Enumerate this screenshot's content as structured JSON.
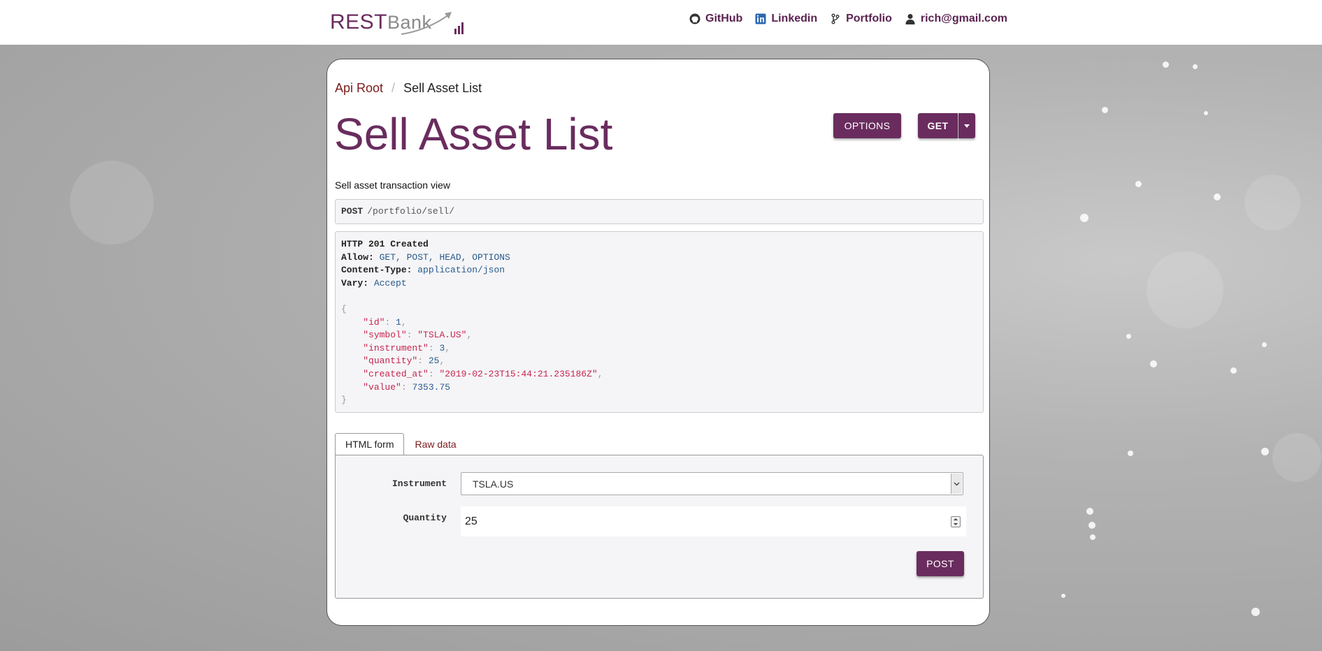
{
  "navbar": {
    "brand_rest": "REST",
    "brand_bank": "Bank",
    "links": [
      {
        "label": "GitHub",
        "icon": "github-icon"
      },
      {
        "label": "Linkedin",
        "icon": "linkedin-icon"
      },
      {
        "label": "Portfolio",
        "icon": "branch-icon"
      },
      {
        "label": "rich@gmail.com",
        "icon": "user-icon"
      }
    ]
  },
  "breadcrumb": {
    "root": "Api Root",
    "separator": "/",
    "current": "Sell Asset List"
  },
  "page": {
    "title": "Sell Asset List",
    "description": "Sell asset transaction view"
  },
  "actions": {
    "options_label": "OPTIONS",
    "get_label": "GET"
  },
  "request": {
    "method": "POST",
    "url": "/portfolio/sell/"
  },
  "response": {
    "status": "HTTP 201 Created",
    "headers": [
      {
        "key": "Allow:",
        "value": "GET, POST, HEAD, OPTIONS"
      },
      {
        "key": "Content-Type:",
        "value": "application/json"
      },
      {
        "key": "Vary:",
        "value": "Accept"
      }
    ],
    "body": {
      "id": "1",
      "symbol": "\"TSLA.US\"",
      "instrument": "3",
      "quantity": "25",
      "created_at": "\"2019-02-23T15:44:21.235186Z\"",
      "value": "7353.75"
    },
    "keys": {
      "id": "\"id\"",
      "symbol": "\"symbol\"",
      "instrument": "\"instrument\"",
      "quantity": "\"quantity\"",
      "created_at": "\"created_at\"",
      "value": "\"value\""
    }
  },
  "tabs": [
    {
      "label": "HTML form",
      "active": true
    },
    {
      "label": "Raw data",
      "active": false
    }
  ],
  "form": {
    "instrument_label": "Instrument",
    "instrument_value": "TSLA.US",
    "quantity_label": "Quantity",
    "quantity_value": "25",
    "submit_label": "POST"
  },
  "colors": {
    "brand": "#6a2c5e",
    "link": "#7a1b1b",
    "header_value": "#2a5a8c",
    "json_string": "#c7254e"
  }
}
